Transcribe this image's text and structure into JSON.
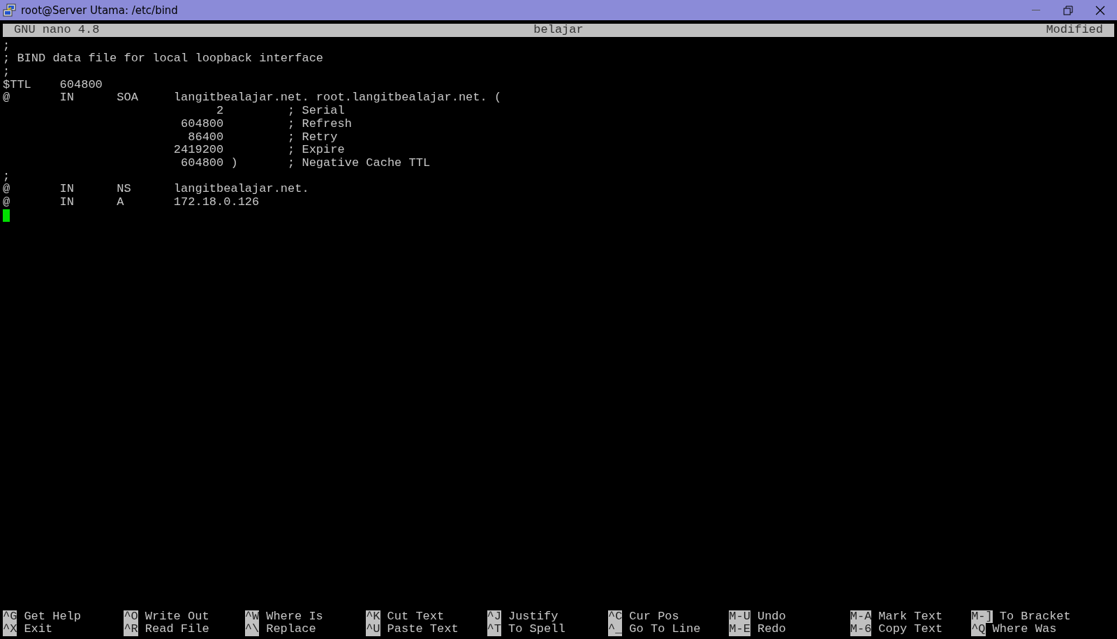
{
  "window": {
    "title": "root@Server Utama: /etc/bind"
  },
  "header": {
    "app": "GNU nano 4.8",
    "filename": "belajar",
    "status": "Modified"
  },
  "lines": [
    ";",
    "; BIND data file for local loopback interface",
    ";",
    "$TTL    604800",
    "@       IN      SOA     langitbealajar.net. root.langitbealajar.net. (",
    "                              2         ; Serial",
    "                         604800         ; Refresh",
    "                          86400         ; Retry",
    "                        2419200         ; Expire",
    "                         604800 )       ; Negative Cache TTL",
    ";",
    "@       IN      NS      langitbealajar.net.",
    "@       IN      A       172.18.0.126"
  ],
  "shortcuts": [
    [
      {
        "key": "^G",
        "label": "Get Help"
      },
      {
        "key": "^X",
        "label": "Exit"
      }
    ],
    [
      {
        "key": "^O",
        "label": "Write Out"
      },
      {
        "key": "^R",
        "label": "Read File"
      }
    ],
    [
      {
        "key": "^W",
        "label": "Where Is"
      },
      {
        "key": "^\\",
        "label": "Replace"
      }
    ],
    [
      {
        "key": "^K",
        "label": "Cut Text"
      },
      {
        "key": "^U",
        "label": "Paste Text"
      }
    ],
    [
      {
        "key": "^J",
        "label": "Justify"
      },
      {
        "key": "^T",
        "label": "To Spell"
      }
    ],
    [
      {
        "key": "^C",
        "label": "Cur Pos"
      },
      {
        "key": "^_",
        "label": "Go To Line"
      }
    ],
    [
      {
        "key": "M-U",
        "label": "Undo"
      },
      {
        "key": "M-E",
        "label": "Redo"
      }
    ],
    [
      {
        "key": "M-A",
        "label": "Mark Text"
      },
      {
        "key": "M-6",
        "label": "Copy Text"
      }
    ],
    [
      {
        "key": "M-]",
        "label": "To Bracket"
      },
      {
        "key": "^Q",
        "label": "Where Was"
      }
    ]
  ]
}
